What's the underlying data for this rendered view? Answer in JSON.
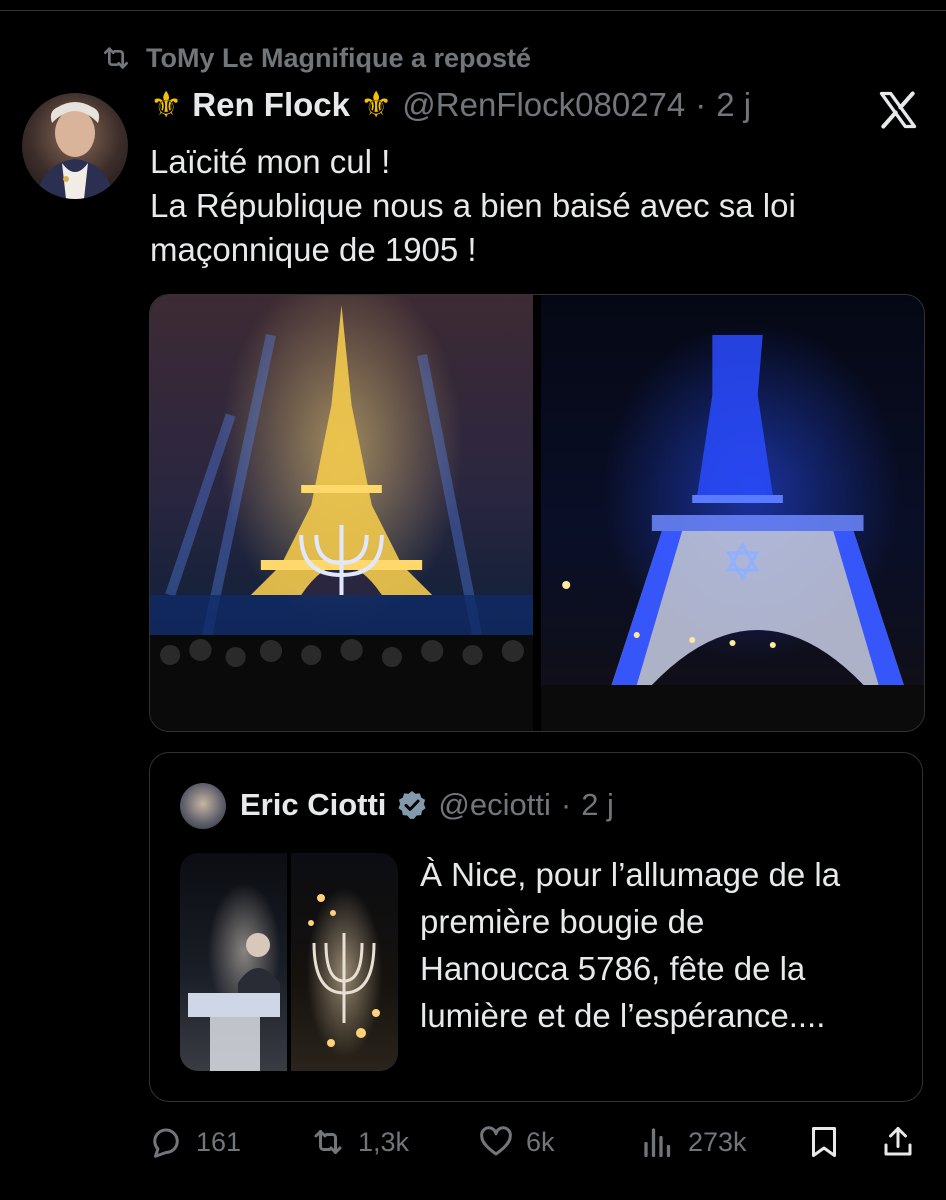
{
  "repost": {
    "text": "ToMy Le Magnifique a reposté",
    "icon": "repost-icon"
  },
  "tweet": {
    "author_name": "Ren Flock",
    "author_name_decoration": "⚜",
    "handle": "@RenFlock080274",
    "separator": "·",
    "age": "2 j",
    "brand_icon": "x-logo-icon",
    "text_lines": [
      "Laïcité mon cul !",
      "La République nous a bien baisé avec sa loi",
      "maçonnique de 1905 !"
    ],
    "media": [
      {
        "label": "",
        "description_icon": "photo"
      },
      {
        "label": "",
        "description_icon": "photo"
      }
    ]
  },
  "quote": {
    "author_name": "Eric Ciotti",
    "verified_icon": "verified-badge-icon",
    "handle": "@eciotti",
    "separator": "·",
    "age": "2 j",
    "text_lines": [
      "À Nice, pour l’allumage de la",
      "première bougie de",
      "Hanoucca 5786, fête de la",
      "lumière et de l’espérance...."
    ]
  },
  "actions": {
    "replies": "161",
    "reposts": "1,3k",
    "likes": "6k",
    "views": "273k"
  },
  "colors": {
    "background": "#000000",
    "text": "#e7e9ea",
    "muted": "#71767b",
    "border": "#2f3336",
    "verified": "#829aab",
    "fleur": "#f2c200"
  }
}
